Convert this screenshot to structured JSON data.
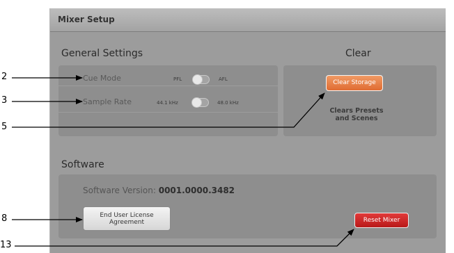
{
  "window": {
    "title": "Mixer Setup"
  },
  "general": {
    "title": "General Settings",
    "cue_mode": {
      "label": "Cue Mode",
      "left": "PFL",
      "right": "AFL",
      "value": "PFL"
    },
    "sample_rate": {
      "label": "Sample Rate",
      "left": "44.1 kHz",
      "right": "48.0 kHz",
      "value": "44.1 kHz"
    }
  },
  "clear": {
    "title": "Clear",
    "button_label": "Clear Storage",
    "note_line1": "Clears Presets",
    "note_line2": "and Scenes"
  },
  "software": {
    "title": "Software",
    "version_label": "Software Version:",
    "version_value": "0001.0000.3482",
    "eula_line1": "End User License",
    "eula_line2": "Agreement",
    "reset_label": "Reset Mixer"
  },
  "callouts": [
    "2",
    "3",
    "5",
    "8",
    "13"
  ],
  "colors": {
    "panel": "#9c9c9c",
    "clear_button": "#e87a42",
    "reset_button": "#cc2222"
  }
}
